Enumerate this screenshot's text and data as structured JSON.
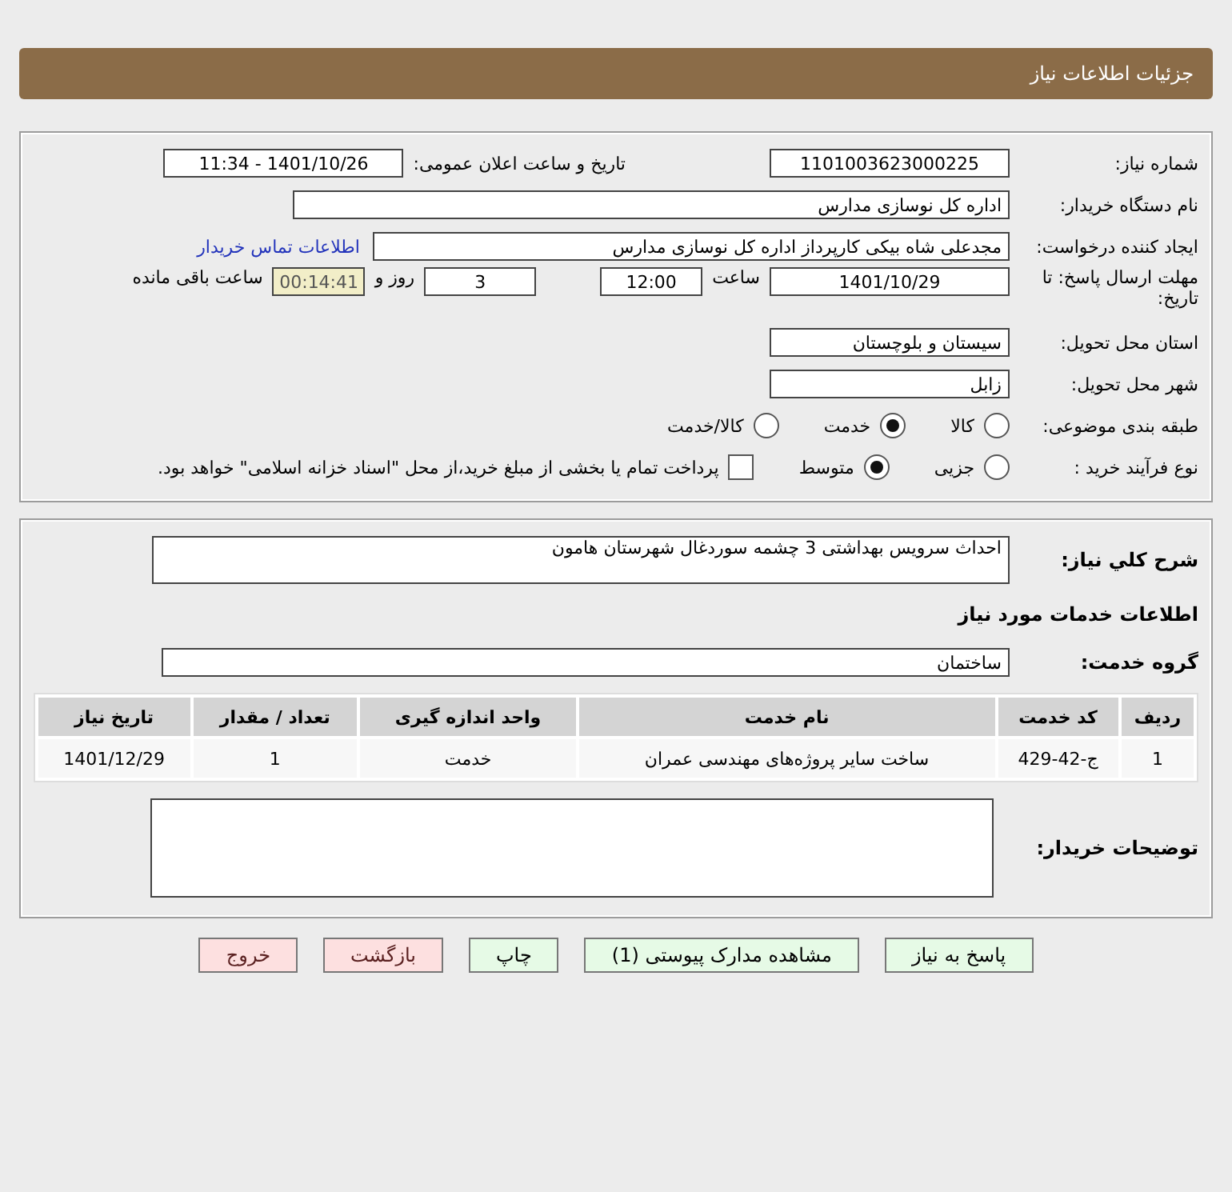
{
  "header": {
    "title": "جزئیات اطلاعات نیاز"
  },
  "need_number": {
    "label": "شماره نیاز:",
    "value": "1101003623000225"
  },
  "announce": {
    "label": "تاریخ و ساعت اعلان عمومی:",
    "value": "1401/10/26 - 11:34"
  },
  "buyer_org": {
    "label": "نام دستگاه خریدار:",
    "value": "اداره کل نوسازی مدارس"
  },
  "requester": {
    "label": "ایجاد کننده درخواست:",
    "value": "مجدعلی شاه بیکی کارپرداز اداره کل نوسازی مدارس"
  },
  "contact_link": "اطلاعات تماس خریدار",
  "deadline": {
    "label": "مهلت ارسال پاسخ: تا تاریخ:",
    "date": "1401/10/29",
    "time_label": "ساعت",
    "time": "12:00",
    "days": "3",
    "days_label": "روز و",
    "remaining": "00:14:41",
    "remaining_label": "ساعت باقی مانده"
  },
  "province": {
    "label": "استان محل تحویل:",
    "value": "سیستان و بلوچستان"
  },
  "city": {
    "label": "شهر محل تحویل:",
    "value": "زابل"
  },
  "category": {
    "label": "طبقه بندی موضوعی:",
    "options": [
      {
        "label": "کالا",
        "selected": false
      },
      {
        "label": "خدمت",
        "selected": true
      },
      {
        "label": "کالا/خدمت",
        "selected": false
      }
    ]
  },
  "process": {
    "label": "نوع فرآیند خرید :",
    "options": [
      {
        "label": "جزیی",
        "selected": false
      },
      {
        "label": "متوسط",
        "selected": true
      }
    ],
    "payment": {
      "checked": false,
      "text": "پرداخت تمام یا بخشی از مبلغ خرید،از محل \"اسناد خزانه اسلامی\" خواهد بود."
    }
  },
  "description": {
    "label": "شرح کلي نياز:",
    "value": "احداث سرویس بهداشتی 3 چشمه سوردغال شهرستان هامون"
  },
  "services_title": "اطلاعات خدمات مورد نیاز",
  "service_group": {
    "label": "گروه خدمت:",
    "value": "ساختمان"
  },
  "table": {
    "columns": [
      "ردیف",
      "کد خدمت",
      "نام خدمت",
      "واحد اندازه گیری",
      "تعداد / مقدار",
      "تاریخ نیاز"
    ],
    "rows": [
      [
        "1",
        "ج-42-429",
        "ساخت سایر پروژه‌های مهندسی عمران",
        "خدمت",
        "1",
        "1401/12/29"
      ]
    ]
  },
  "buyer_notes": {
    "label": "توضیحات خریدار:"
  },
  "buttons": [
    {
      "label": "پاسخ به نیاز",
      "kind": "normal"
    },
    {
      "label": "مشاهده مدارک پیوستی (1)",
      "kind": "normal"
    },
    {
      "label": "چاپ",
      "kind": "normal"
    },
    {
      "label": "بازگشت",
      "kind": "danger"
    },
    {
      "label": "خروج",
      "kind": "danger"
    }
  ]
}
